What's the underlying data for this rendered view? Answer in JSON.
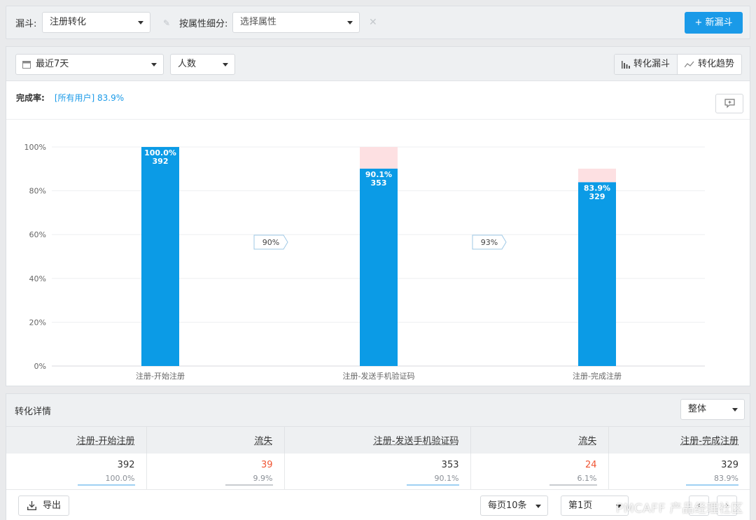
{
  "toolbar": {
    "funnel_label": "漏斗:",
    "funnel_value": "注册转化",
    "segment_label": "按属性细分:",
    "segment_placeholder": "选择属性",
    "new_funnel_label": "+ 新漏斗"
  },
  "panel": {
    "date_range": "最近7天",
    "metric": "人数",
    "view_tabs": [
      "转化漏斗",
      "转化趋势"
    ],
    "active_view": "转化漏斗",
    "completion_label": "完成率:",
    "completion_value": "[所有用户] 83.9%"
  },
  "chart_data": {
    "type": "bar",
    "categories": [
      "注册-开始注册",
      "注册-发送手机验证码",
      "注册-完成注册"
    ],
    "values": [
      100.0,
      90.1,
      83.9
    ],
    "counts": [
      392,
      353,
      329
    ],
    "value_labels": [
      "100.0%",
      "90.1%",
      "83.9%"
    ],
    "loss_tops": [
      100.0,
      100.0,
      90.1
    ],
    "step_conversion": [
      "90%",
      "93%"
    ],
    "y_ticks": [
      "0%",
      "20%",
      "40%",
      "60%",
      "80%",
      "100%"
    ],
    "ylim": [
      0,
      100
    ],
    "grid": true,
    "colors": {
      "bar": "#0b9be6",
      "loss": "#fde0e2"
    }
  },
  "details": {
    "title": "转化详情",
    "scope": "整体",
    "columns": [
      "注册-开始注册",
      "流失",
      "注册-发送手机验证码",
      "流失",
      "注册-完成注册"
    ],
    "values": [
      "392",
      "39",
      "353",
      "24",
      "329"
    ],
    "percents": [
      "100.0%",
      "9.9%",
      "90.1%",
      "6.1%",
      "83.9%"
    ],
    "export_label": "导出",
    "page_size": "每页10条",
    "page": "第1页",
    "prev": "‹",
    "next": "›"
  },
  "watermark": "PMCAFF 产品经理社区"
}
